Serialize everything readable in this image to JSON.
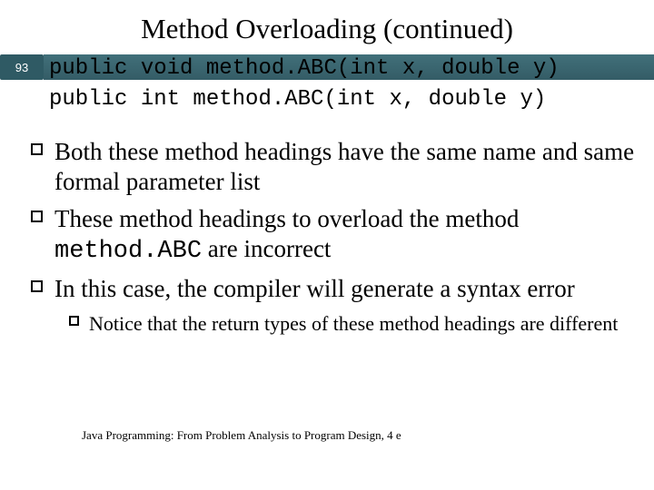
{
  "slide": {
    "number": "93",
    "title": "Method Overloading (continued)",
    "code": {
      "line1": "public void method.ABC(int x, double y)",
      "line2": "public int method.ABC(int x, double y)"
    },
    "bullets": [
      {
        "text_a": "Both these method headings have the same name and same formal parameter list"
      },
      {
        "text_a": "These method headings to overload the method ",
        "code": "method.ABC",
        "text_b": " are incorrect"
      },
      {
        "text_a": "In this case, the compiler will generate a syntax error"
      }
    ],
    "subbullet": "Notice that the return types of these method headings are different",
    "footer": "Java Programming: From Problem Analysis to Program Design, 4 e"
  }
}
